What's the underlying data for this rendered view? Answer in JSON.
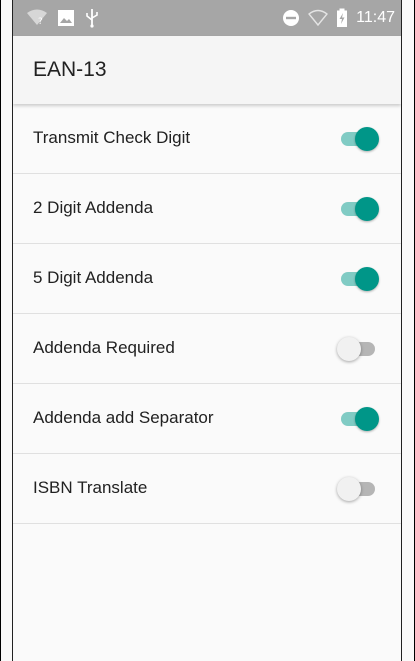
{
  "status_bar": {
    "time": "11:47",
    "left_icons": [
      "wifi-question-icon",
      "image-icon",
      "usb-icon"
    ],
    "right_icons": [
      "do-not-disturb-icon",
      "signal-icon",
      "battery-charging-icon"
    ],
    "background": "#a6a6a6"
  },
  "app_bar": {
    "title": "EAN-13"
  },
  "settings": [
    {
      "label": "Transmit Check Digit",
      "enabled": true
    },
    {
      "label": "2 Digit Addenda",
      "enabled": true
    },
    {
      "label": "5 Digit Addenda",
      "enabled": true
    },
    {
      "label": "Addenda Required",
      "enabled": false
    },
    {
      "label": "Addenda add Separator",
      "enabled": true
    },
    {
      "label": "ISBN Translate",
      "enabled": false
    }
  ],
  "colors": {
    "accent": "#009688",
    "accent_track": "#80cbc4",
    "off_thumb": "#f1f1f1",
    "off_track": "#b5b5b5"
  }
}
